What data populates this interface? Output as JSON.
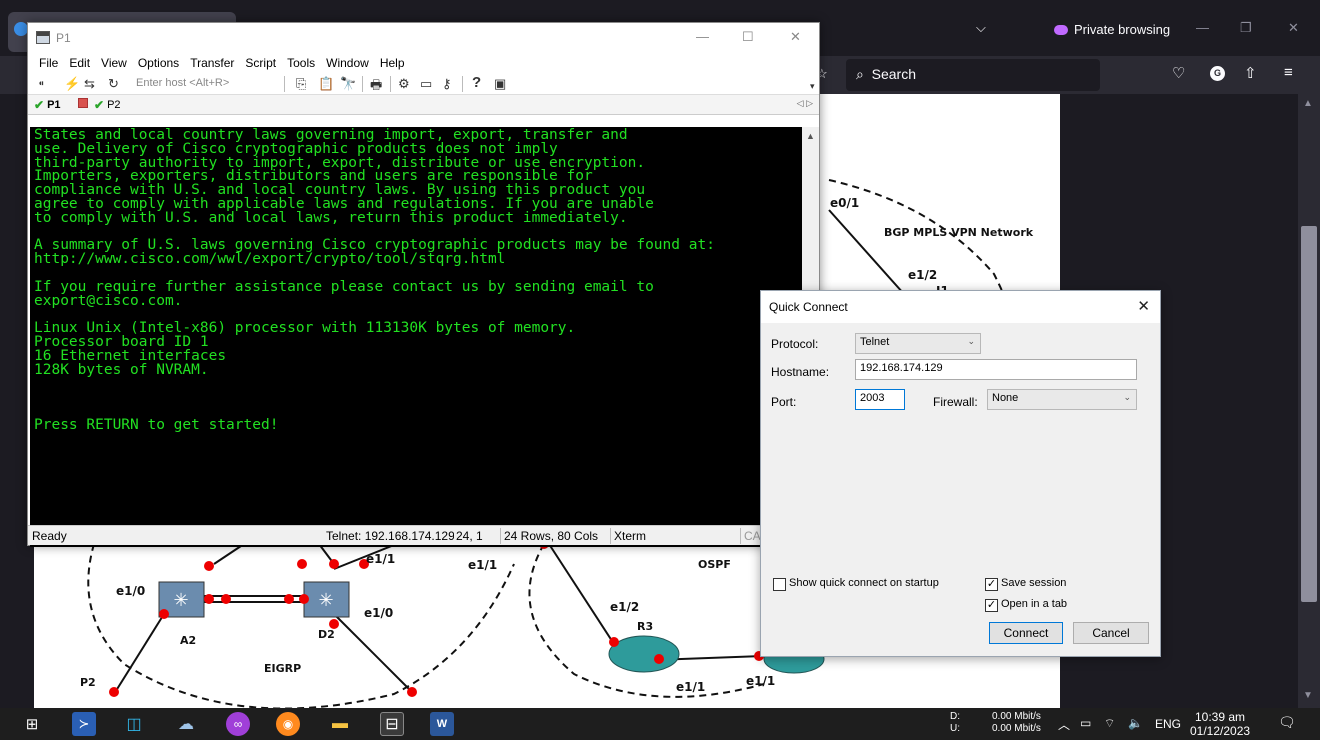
{
  "firefox": {
    "private_label": "Private browsing",
    "search_label": "Search"
  },
  "diagram": {
    "labels": {
      "e0_1": "e0/1",
      "bgp_title": "BGP MPLS VPN Network",
      "e1_2_top": "e1/2",
      "i1": "I1",
      "e1_1_a": "e1/1",
      "e1_1_b": "e1/1",
      "ospf": "OSPF",
      "e1_0_left": "e1/0",
      "e1_0_mid": "e1/0",
      "e1_2_bottom": "e1/2",
      "r3": "R3",
      "a2": "A2",
      "d2": "D2",
      "eigrp": "EIGRP",
      "p2": "P2",
      "e1_1_c": "e1/1",
      "e1_1_d": "e1/1"
    }
  },
  "securecrt": {
    "title": "P1",
    "menu": [
      "File",
      "Edit",
      "View",
      "Options",
      "Transfer",
      "Script",
      "Tools",
      "Window",
      "Help"
    ],
    "host_placeholder": "Enter host <Alt+R>",
    "tabs": [
      {
        "label": "P1"
      },
      {
        "label": "P2"
      }
    ],
    "terminal_text": "States and local country laws governing import, export, transfer and\nuse. Delivery of Cisco cryptographic products does not imply\nthird-party authority to import, export, distribute or use encryption.\nImporters, exporters, distributors and users are responsible for\ncompliance with U.S. and local country laws. By using this product you\nagree to comply with applicable laws and regulations. If you are unable\nto comply with U.S. and local laws, return this product immediately.\n\nA summary of U.S. laws governing Cisco cryptographic products may be found at:\nhttp://www.cisco.com/wwl/export/crypto/tool/stqrg.html\n\nIf you require further assistance please contact us by sending email to\nexport@cisco.com.\n\nLinux Unix (Intel-x86) processor with 113130K bytes of memory.\nProcessor board ID 1\n16 Ethernet interfaces\n128K bytes of NVRAM.\n\n\n\nPress RETURN to get started!",
    "status": {
      "ready": "Ready",
      "connection": "Telnet: 192.168.174.129",
      "position": "24,  1",
      "size": "24 Rows, 80 Cols",
      "emulation": "Xterm",
      "caps": "CA"
    }
  },
  "quick_connect": {
    "title": "Quick Connect",
    "protocol_label": "Protocol:",
    "protocol_value": "Telnet",
    "hostname_label": "Hostname:",
    "hostname_value": "192.168.174.129",
    "port_label": "Port:",
    "port_value": "2003",
    "firewall_label": "Firewall:",
    "firewall_value": "None",
    "show_on_startup_label": "Show quick connect on startup",
    "show_on_startup_checked": false,
    "save_session_label": "Save session",
    "save_session_checked": true,
    "open_in_tab_label": "Open in a tab",
    "open_in_tab_checked": true,
    "connect_label": "Connect",
    "cancel_label": "Cancel"
  },
  "taskbar": {
    "net_labels": "D:\nU:",
    "net_speeds": "0.00 Mbit/s\n0.00 Mbit/s",
    "language": "ENG",
    "time": "10:39 am",
    "date": "01/12/2023"
  }
}
